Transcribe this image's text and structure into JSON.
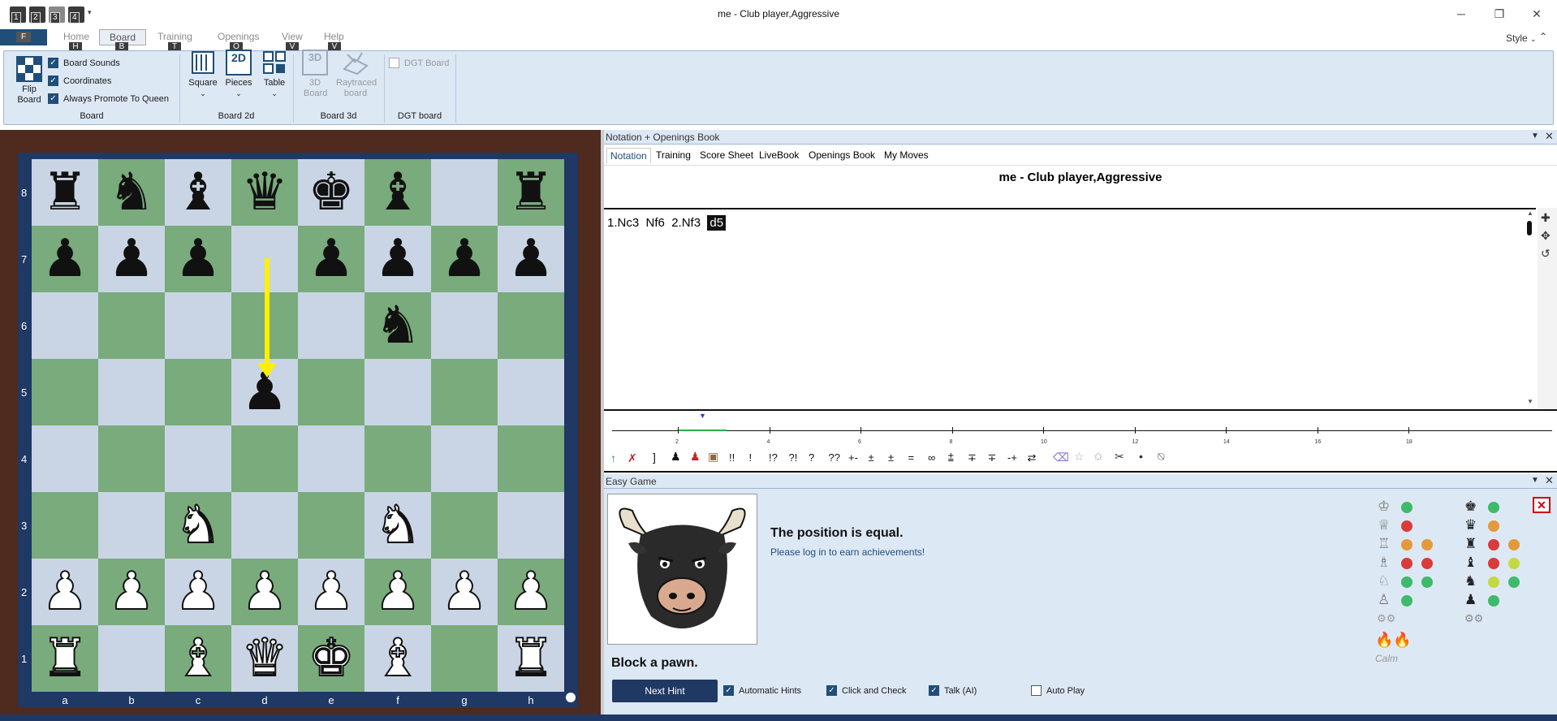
{
  "window": {
    "title": "me - Club player,Aggressive",
    "quick_access": [
      "1",
      "2",
      "3",
      "4"
    ],
    "controls": [
      "─",
      "❐",
      "✕"
    ]
  },
  "menu": {
    "file_key": "F",
    "items": [
      {
        "label": "Home",
        "key": "H"
      },
      {
        "label": "Board",
        "key": "B"
      },
      {
        "label": "Training",
        "key": "T"
      },
      {
        "label": "Openings",
        "key": "O"
      },
      {
        "label": "View",
        "key": "V"
      },
      {
        "label": "Help",
        "key": "V"
      }
    ],
    "style_label": "Style"
  },
  "ribbon": {
    "board_group": {
      "flip_label": "Flip Board",
      "checks": [
        {
          "label": "Board Sounds",
          "checked": true
        },
        {
          "label": "Coordinates",
          "checked": true
        },
        {
          "label": "Always Promote To Queen",
          "checked": true
        }
      ],
      "group_label": "Board"
    },
    "board2d_group": {
      "square_label": "Square",
      "pieces_label": "Pieces",
      "pieces_icon_text": "2D",
      "table_label": "Table",
      "group_label": "Board 2d"
    },
    "board3d_group": {
      "board3d_label": "3D Board",
      "board3d_icon_text": "3D",
      "raytraced_label": "Raytraced board",
      "group_label": "Board 3d"
    },
    "dgt_group": {
      "dgt_check_label": "DGT Board",
      "group_label": "DGT board"
    }
  },
  "board": {
    "ranks": [
      "8",
      "7",
      "6",
      "5",
      "4",
      "3",
      "2",
      "1"
    ],
    "files": [
      "a",
      "b",
      "c",
      "d",
      "e",
      "f",
      "g",
      "h"
    ],
    "position": [
      [
        "r",
        "n",
        "b",
        "q",
        "k",
        "b",
        "",
        "r"
      ],
      [
        "p",
        "p",
        "p",
        "",
        "p",
        "p",
        "p",
        "p"
      ],
      [
        "",
        "",
        "",
        "",
        "",
        "n",
        "",
        ""
      ],
      [
        "",
        "",
        "",
        "p",
        "",
        "",
        "",
        ""
      ],
      [
        "",
        "",
        "",
        "",
        "",
        "",
        "",
        ""
      ],
      [
        "",
        "",
        "N",
        "",
        "",
        "N",
        "",
        ""
      ],
      [
        "P",
        "P",
        "P",
        "P",
        "P",
        "P",
        "P",
        "P"
      ],
      [
        "R",
        "",
        "B",
        "Q",
        "K",
        "B",
        "",
        "R"
      ]
    ]
  },
  "notation_panel": {
    "title": "Notation + Openings Book",
    "tabs": [
      "Notation",
      "Training",
      "Score Sheet",
      "LiveBook",
      "Openings Book",
      "My Moves"
    ],
    "game_header": "me - Club player,Aggressive",
    "moves": [
      "1.Nc3",
      "Nf6",
      "2.Nf3"
    ],
    "current_move": "d5",
    "timeline_ticks": [
      "2",
      "4",
      "6",
      "8",
      "10",
      "12",
      "14",
      "16",
      "18"
    ],
    "annotation_symbols": [
      "!!",
      "!",
      "!?",
      "?!",
      "?",
      "??",
      "+-",
      "±",
      "±",
      "=",
      "∞",
      "⩲",
      "∓",
      "∓",
      "-+",
      "⇄"
    ]
  },
  "easy_game": {
    "title": "Easy Game",
    "eval_text": "The position is equal.",
    "login_text": "Please log in to earn achievements!",
    "hint_text": "Block a pawn.",
    "next_hint_label": "Next Hint",
    "options": [
      {
        "label": "Automatic Hints",
        "checked": true
      },
      {
        "label": "Click and Check",
        "checked": true
      },
      {
        "label": "Talk (AI)",
        "checked": true
      },
      {
        "label": "Auto Play",
        "checked": false
      }
    ],
    "mood": "Calm",
    "white_status": [
      [
        "g"
      ],
      [
        "r"
      ],
      [
        "o",
        "o"
      ],
      [
        "r",
        "r"
      ],
      [
        "g",
        "g"
      ],
      [
        "g"
      ]
    ],
    "black_status": [
      [
        "g"
      ],
      [
        "o"
      ],
      [
        "r",
        "o"
      ],
      [
        "r",
        "y"
      ],
      [
        "y",
        "g"
      ],
      [
        "g"
      ]
    ]
  }
}
